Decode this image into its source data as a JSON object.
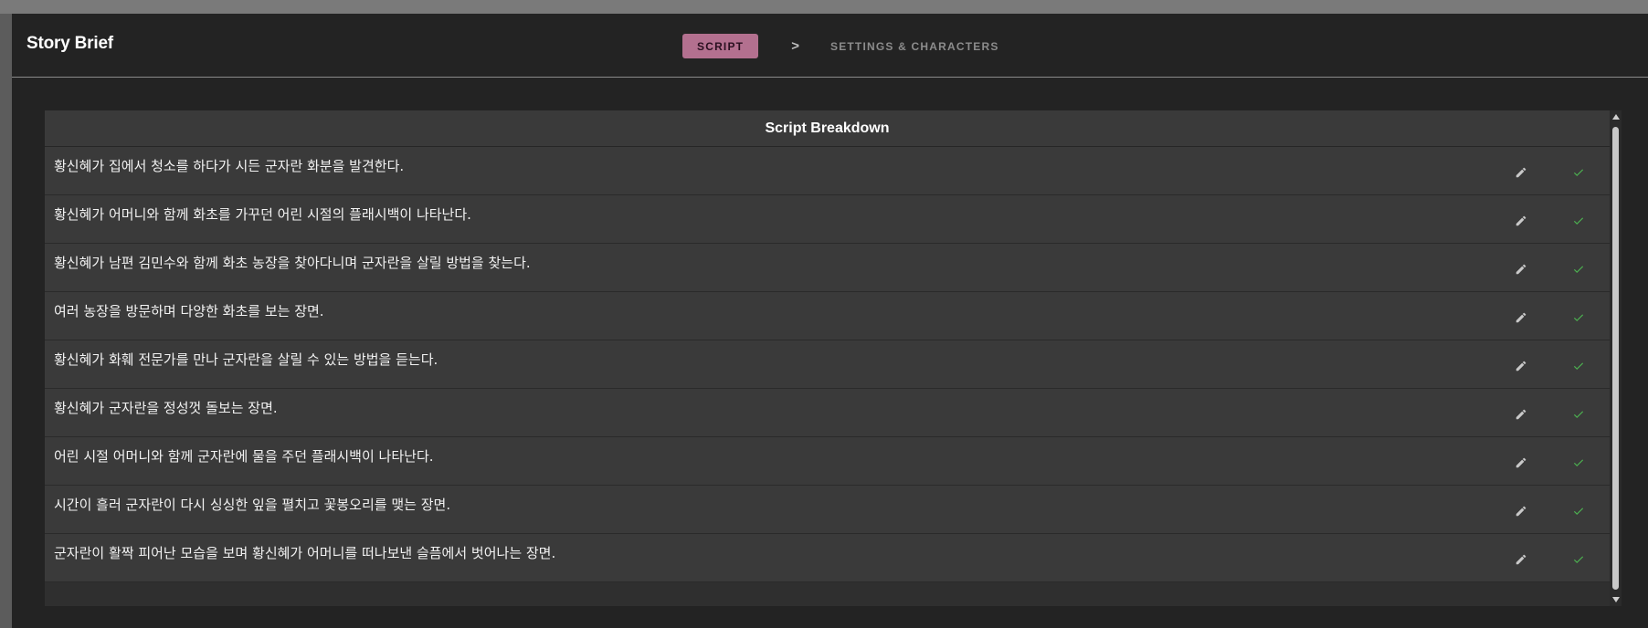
{
  "header": {
    "title": "Story Brief"
  },
  "stepper": {
    "current": "SCRIPT",
    "separator": ">",
    "next": "SETTINGS & CHARACTERS",
    "accent": "#b3708f"
  },
  "table": {
    "heading": "Script Breakdown",
    "rows": [
      "황신혜가 집에서 청소를 하다가 시든 군자란 화분을 발견한다.",
      "황신혜가 어머니와 함께 화초를 가꾸던 어린 시절의 플래시백이 나타난다.",
      "황신혜가 남편 김민수와 함께 화초 농장을 찾아다니며 군자란을 살릴 방법을 찾는다.",
      "여러 농장을 방문하며 다양한 화초를 보는 장면.",
      "황신혜가 화훼 전문가를 만나 군자란을 살릴 수 있는 방법을 듣는다.",
      "황신혜가 군자란을 정성껏 돌보는 장면.",
      "어린 시절 어머니와 함께 군자란에 물을 주던 플래시백이 나타난다.",
      "시간이 흘러 군자란이 다시 싱싱한 잎을 펼치고 꽃봉오리를 맺는 장면.",
      "군자란이 활짝 피어난 모습을 보며 황신혜가 어머니를 떠나보낸 슬픔에서 벗어나는 장면."
    ],
    "row_icons": [
      "pencil-icon",
      "check-icon"
    ],
    "check_color": "#4caf50"
  }
}
